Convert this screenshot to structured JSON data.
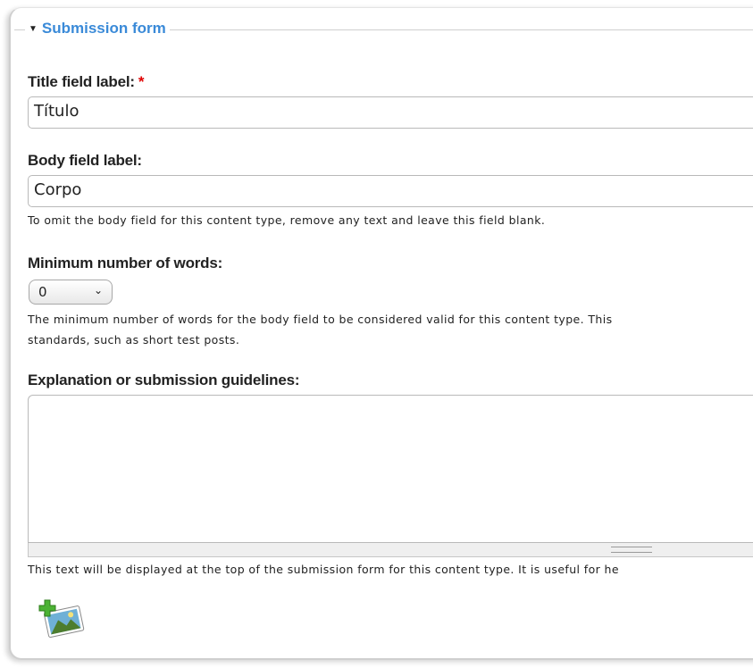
{
  "fieldset": {
    "legend": "Submission form"
  },
  "title_field": {
    "label": "Title field label:",
    "required_marker": "*",
    "value": "Título"
  },
  "body_field": {
    "label": "Body field label:",
    "value": "Corpo",
    "description": "To omit the body field for this content type, remove any text and leave this field blank."
  },
  "min_words": {
    "label": "Minimum number of words:",
    "selected": "0",
    "description_line1": "The minimum number of words for the body field to be considered valid for this content type. This",
    "description_line2": "standards, such as short test posts."
  },
  "guidelines": {
    "label": "Explanation or submission guidelines:",
    "value": "",
    "description": "This text will be displayed at the top of the submission form for this content type. It is useful for he"
  },
  "icons": {
    "legend_toggle": "triangle-down-icon",
    "select_chevron": "chevron-down-icon",
    "add_image": "add-image-icon"
  },
  "colors": {
    "legend": "#3a8ad8",
    "required": "#e00000"
  }
}
